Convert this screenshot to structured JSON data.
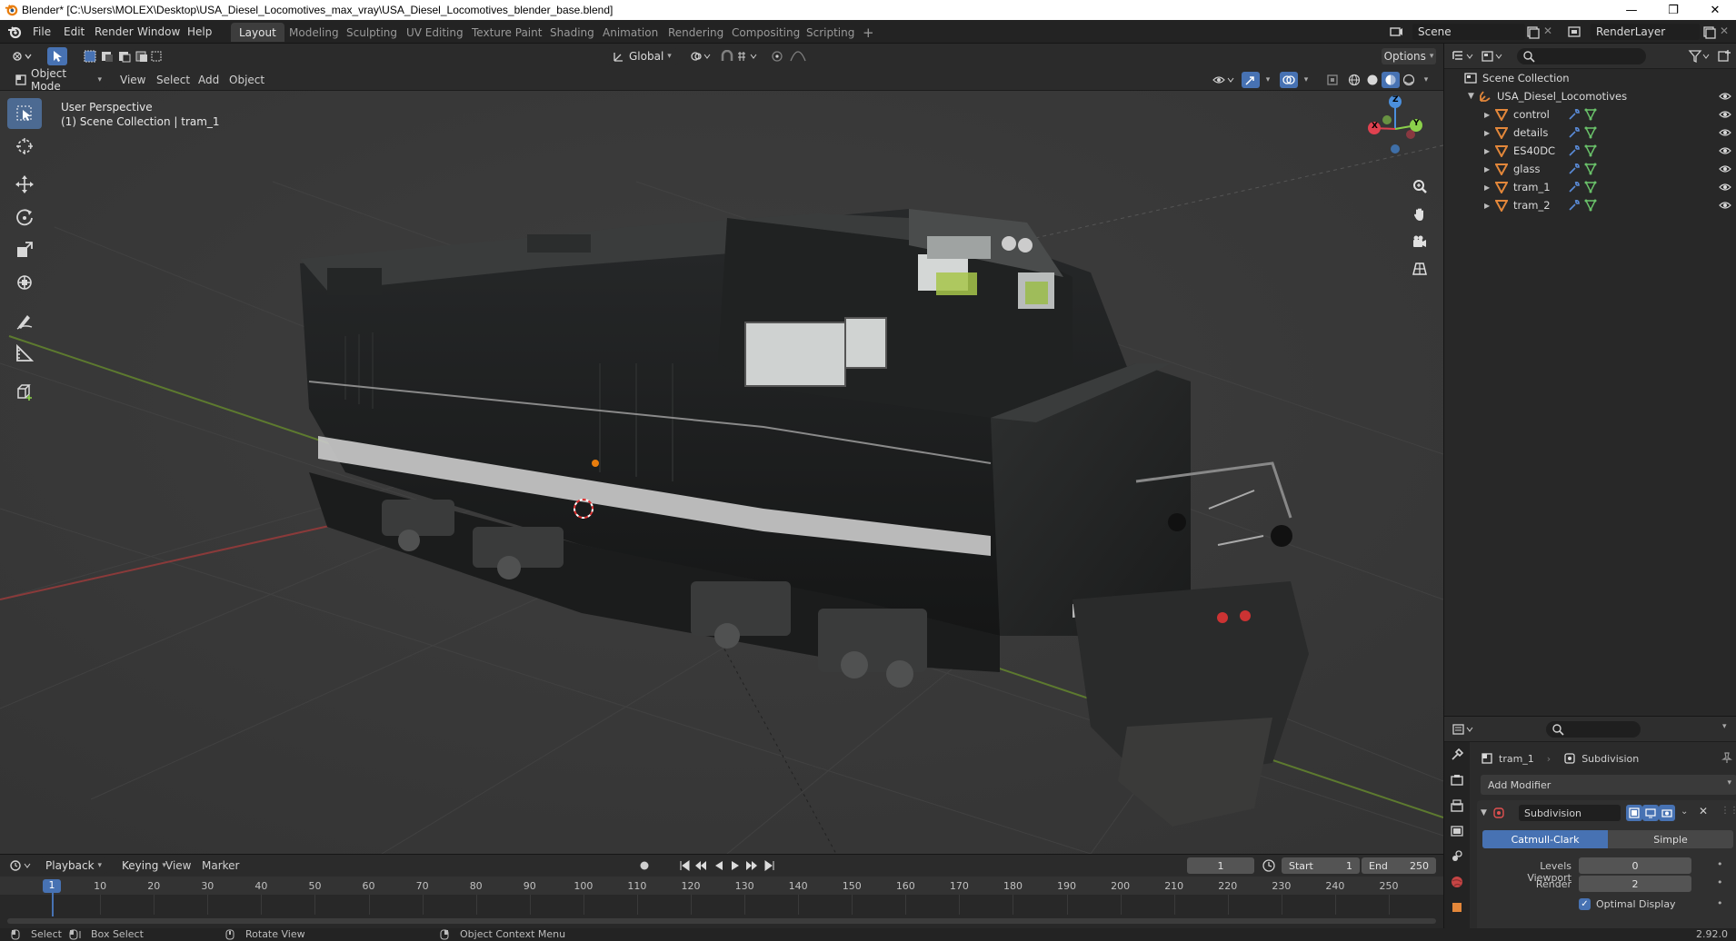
{
  "window": {
    "title": "Blender* [C:\\Users\\MOLEX\\Desktop\\USA_Diesel_Locomotives_max_vray\\USA_Diesel_Locomotives_blender_base.blend]",
    "minimize": "—",
    "maximize": "❐",
    "close": "✕"
  },
  "menu": {
    "items": [
      "File",
      "Edit",
      "Render",
      "Window",
      "Help"
    ]
  },
  "workspaces": {
    "tabs": [
      "Layout",
      "Modeling",
      "Sculpting",
      "UV Editing",
      "Texture Paint",
      "Shading",
      "Animation",
      "Rendering",
      "Compositing",
      "Scripting"
    ],
    "active": "Layout",
    "add": "+"
  },
  "scene": {
    "name": "Scene",
    "render_layer": "RenderLayer"
  },
  "header": {
    "transform_orientation": "Global",
    "options": "Options",
    "mode": "Object Mode",
    "view": "View",
    "select": "Select",
    "add": "Add",
    "object": "Object"
  },
  "viewport": {
    "perspective": "User Perspective",
    "collection_info": "(1) Scene Collection | tram_1",
    "gizmo": {
      "x": "X",
      "y": "Y",
      "z": "Z"
    }
  },
  "outliner": {
    "root": "Scene Collection",
    "collection": "USA_Diesel_Locomotives",
    "objects": [
      "control",
      "details",
      "ES40DC",
      "glass",
      "tram_1",
      "tram_2"
    ]
  },
  "properties": {
    "object_name": "tram_1",
    "modifier_context": "Subdivision",
    "add_modifier": "Add Modifier",
    "modifier_name": "Subdivision",
    "modes": [
      "Catmull-Clark",
      "Simple"
    ],
    "active_mode": "Catmull-Clark",
    "levels_viewport_label": "Levels Viewport",
    "levels_viewport": "0",
    "render_label": "Render",
    "render": "2",
    "optimal_display": "Optimal Display",
    "optimal_display_checked": true
  },
  "timeline": {
    "playback": "Playback",
    "keying": "Keying",
    "view": "View",
    "marker": "Marker",
    "current_frame": "1",
    "start_label": "Start",
    "start": "1",
    "end_label": "End",
    "end": "250",
    "ticks": [
      "1",
      "10",
      "20",
      "30",
      "40",
      "50",
      "60",
      "70",
      "80",
      "90",
      "100",
      "110",
      "120",
      "130",
      "140",
      "150",
      "160",
      "170",
      "180",
      "190",
      "200",
      "210",
      "220",
      "230",
      "240",
      "250"
    ]
  },
  "status": {
    "select": "Select",
    "box_select": "Box Select",
    "rotate_view": "Rotate View",
    "context_menu": "Object Context Menu",
    "version": "2.92.0"
  },
  "colors": {
    "accent": "#4772b3",
    "orange_object": "#e3873a",
    "green_mesh": "#6ac26a",
    "axis_x": "#e0414f",
    "axis_y": "#8bd14b",
    "axis_z": "#4b8fdc",
    "current_frame": "#4772b3"
  }
}
